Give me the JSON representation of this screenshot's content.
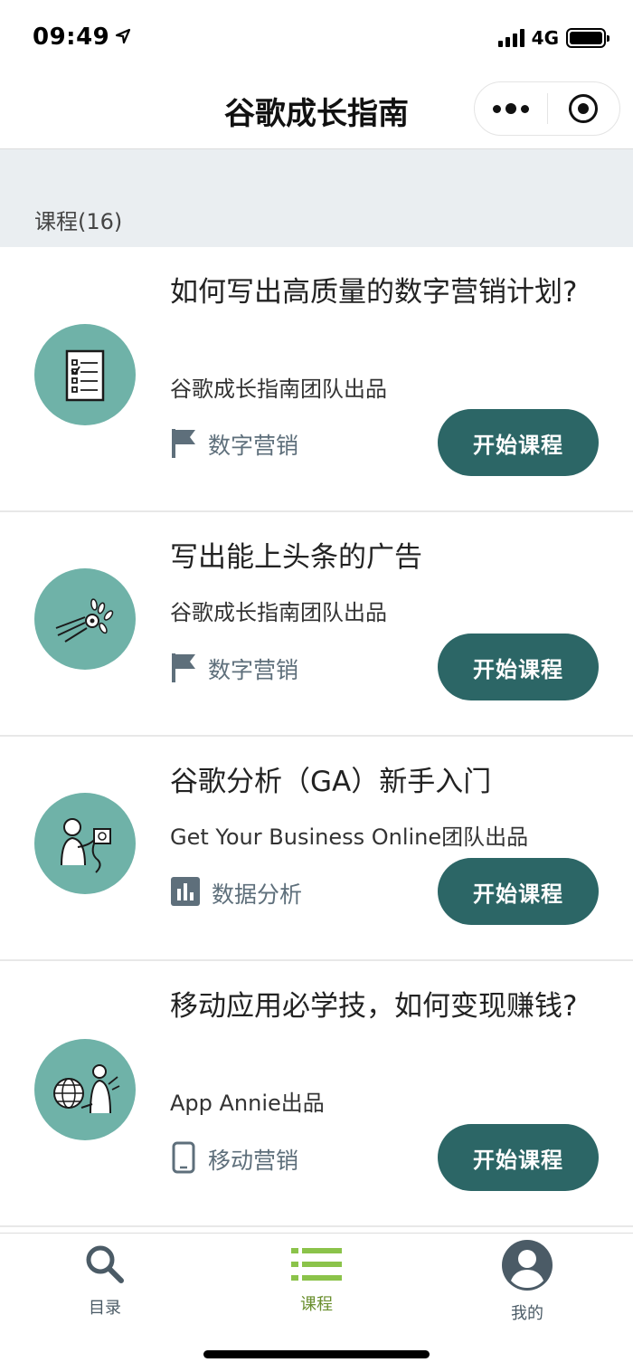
{
  "status_bar": {
    "time": "09:49",
    "network": "4G"
  },
  "nav": {
    "title": "谷歌成长指南"
  },
  "section": {
    "label": "课程(16)"
  },
  "courses": [
    {
      "title": "如何写出高质量的数字营销计划?",
      "author": "谷歌成长指南团队出品",
      "tag": "数字营销",
      "tag_icon": "flag-icon",
      "button": "开始课程"
    },
    {
      "title": "写出能上头条的广告",
      "author": "谷歌成长指南团队出品",
      "tag": "数字营销",
      "tag_icon": "flag-icon",
      "button": "开始课程"
    },
    {
      "title": "谷歌分析（GA）新手入门",
      "author": "Get Your Business Online团队出品",
      "tag": "数据分析",
      "tag_icon": "bar-chart-icon",
      "button": "开始课程"
    },
    {
      "title": "移动应用必学技，如何变现赚钱?",
      "author": "App Annie出品",
      "tag": "移动营销",
      "tag_icon": "mobile-phone-icon",
      "button": "开始课程"
    }
  ],
  "tabbar": {
    "items": [
      {
        "label": "目录",
        "icon": "search-icon",
        "active": false
      },
      {
        "label": "课程",
        "icon": "list-icon",
        "active": true
      },
      {
        "label": "我的",
        "icon": "user-icon",
        "active": false
      }
    ]
  },
  "colors": {
    "accent": "#2c6666",
    "avatar_bg": "#6fb2a8",
    "tab_active": "#8bc34a",
    "tab_inactive": "#4b5b66",
    "section_bg": "#eaeef1"
  }
}
